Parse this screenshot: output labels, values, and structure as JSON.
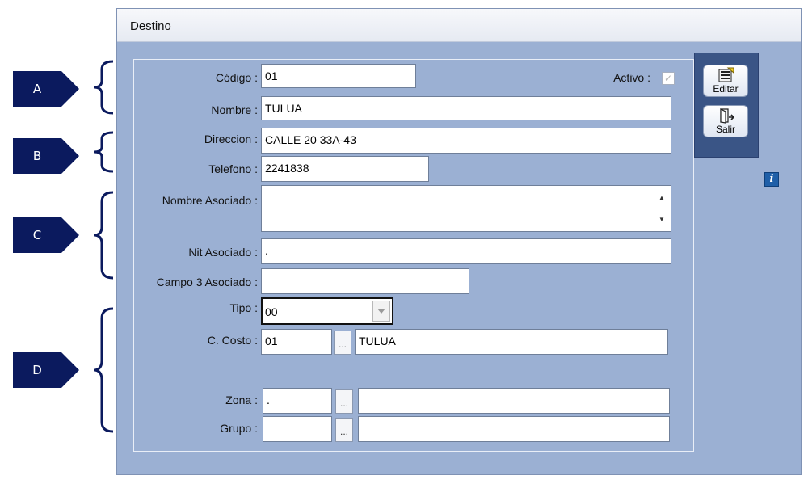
{
  "callouts": [
    "A",
    "B",
    "C",
    "D"
  ],
  "window": {
    "title": "Destino"
  },
  "form": {
    "codigo": {
      "label": "Código :",
      "value": "01"
    },
    "activo": {
      "label": "Activo :",
      "checked": true
    },
    "nombre": {
      "label": "Nombre :",
      "value": "TULUA"
    },
    "direccion": {
      "label": "Direccion :",
      "value": "CALLE 20 33A-43"
    },
    "telefono": {
      "label": "Telefono :",
      "value": "2241838"
    },
    "nombre_asociado": {
      "label": "Nombre Asociado :",
      "value": ""
    },
    "nit_asociado": {
      "label": "Nit Asociado :",
      "value": "."
    },
    "campo3_asociado": {
      "label": "Campo 3 Asociado :",
      "value": ""
    },
    "tipo": {
      "label": "Tipo :",
      "value": "00"
    },
    "c_costo": {
      "label": "C. Costo :",
      "code": "01",
      "button": "...",
      "name": "TULUA"
    },
    "zona": {
      "label": "Zona :",
      "code": ".",
      "button": "...",
      "name": ""
    },
    "grupo": {
      "label": "Grupo :",
      "code": "",
      "button": "...",
      "name": ""
    }
  },
  "toolbar": {
    "edit_label": "Editar",
    "exit_label": "Salir"
  },
  "info_button": {
    "glyph": "i"
  },
  "colors": {
    "window_bg": "#9bb0d3",
    "callout_bg": "#0b1a5e",
    "toolbar_bg": "#3a5586"
  }
}
